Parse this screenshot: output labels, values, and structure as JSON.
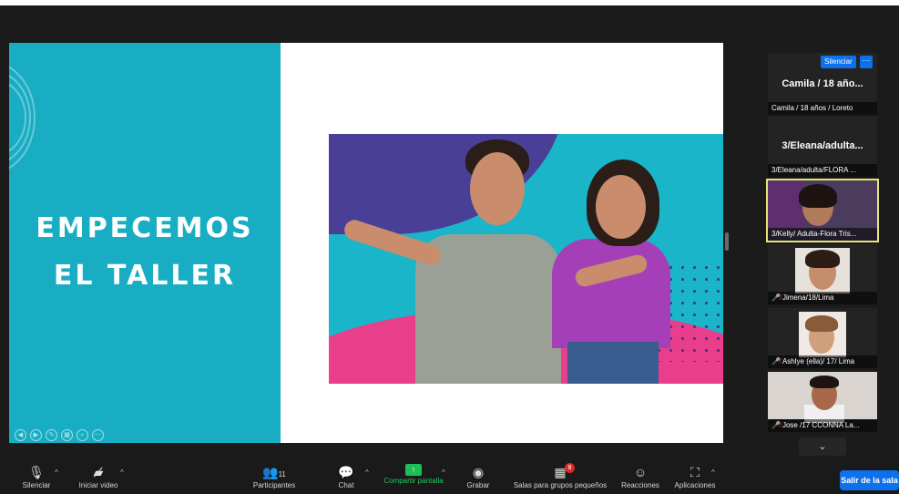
{
  "slide": {
    "title_line1": "EMPECEMOS",
    "title_line2": "EL TALLER",
    "colors": {
      "teal": "#18adc3",
      "purple": "#4a3f97",
      "pink": "#e83e8c"
    }
  },
  "participants": {
    "mute_button": "Silenciar",
    "more_button": "···",
    "tiles": [
      {
        "display_name": "Camila / 18 año...",
        "label": "Camila / 18 años / Loreto"
      },
      {
        "display_name": "3/Eleana/adulta...",
        "label": "3/Eleana/adulta/FLORA ..."
      },
      {
        "label": "3/Kelly/ Adulta-Flora Tris..."
      },
      {
        "label": "Jimena/18/Lima"
      },
      {
        "label": "Ashlye (ella)/ 17/ Lima"
      },
      {
        "label": "Jose /17 CCONNA La..."
      }
    ]
  },
  "toolbar": {
    "mute": "Silenciar",
    "video": "Iniciar video",
    "participants": "Participantes",
    "participants_count": "11",
    "chat": "Chat",
    "share": "Compartir pantalla",
    "record": "Grabar",
    "breakout": "Salas para grupos pequeños",
    "reactions": "Reacciones",
    "apps": "Aplicaciones",
    "leave": "Salir de la sala"
  },
  "colors": {
    "accent": "#0e71eb",
    "share_green": "#1dbf56",
    "speaking_highlight": "#e5e57a"
  }
}
